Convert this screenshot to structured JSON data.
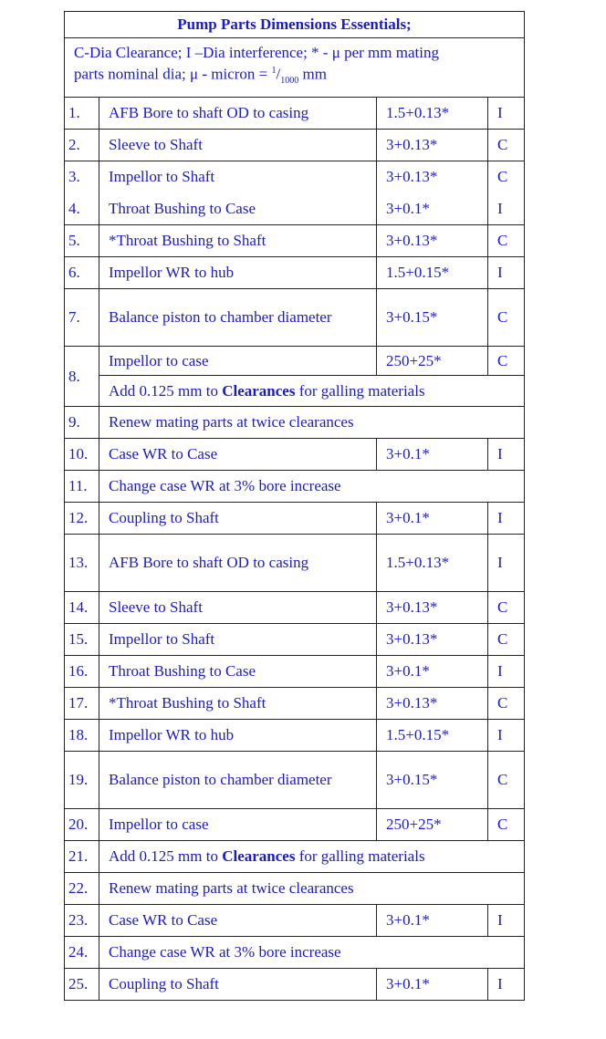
{
  "title": "Pump Parts Dimensions Essentials;",
  "legend": {
    "line1": "C-Dia Clearance; I –Dia  interference; * - μ per mm mating",
    "line2_a": "parts nominal dia; μ - micron = ",
    "sup": "1",
    "slash": "/",
    "sub": "1000",
    "line2_b": " mm"
  },
  "colors": {
    "text": "#1a1ad0",
    "border": "#222222"
  },
  "rows": [
    {
      "num": "1.",
      "part": "AFB Bore to shaft OD to casing",
      "value": "1.5+0.13*",
      "type": "I"
    },
    {
      "num": "2.",
      "part": "Sleeve to Shaft",
      "value": "3+0.13*",
      "type": "C"
    },
    {
      "num": "3.",
      "part": "Impellor to Shaft",
      "value": "3+0.13*",
      "type": "C"
    },
    {
      "num": "4.",
      "part": "Throat Bushing to Case",
      "value": "3+0.1*",
      "type": "I"
    },
    {
      "num": "5.",
      "part": "*Throat Bushing to Shaft",
      "value": "3+0.13*",
      "type": "C"
    },
    {
      "num": "6.",
      "part": "Impellor WR to hub",
      "value": "1.5+0.15*",
      "type": "I"
    },
    {
      "num": "7.",
      "part": "Balance piston to chamber diameter",
      "value": "3+0.15*",
      "type": "C"
    },
    {
      "num": "8.",
      "part": "Impellor to case",
      "value": "250+25*",
      "type": "C",
      "note_a": "Add 0.125 mm to ",
      "note_bold": "Clearances",
      "note_b": " for galling materials"
    },
    {
      "num": "9.",
      "note": "Renew mating parts at twice clearances"
    },
    {
      "num": "10.",
      "part": "Case WR to Case",
      "value": "3+0.1*",
      "type": "I"
    },
    {
      "num": "11.",
      "note": "Change case WR at 3% bore increase"
    },
    {
      "num": "12.",
      "part": "Coupling to Shaft",
      "value": "3+0.1*",
      "type": "I"
    },
    {
      "num": "13.",
      "part": "AFB Bore to shaft  OD to casing",
      "value": "1.5+0.13*",
      "type": "I"
    },
    {
      "num": "14.",
      "part": "Sleeve to Shaft",
      "value": "3+0.13*",
      "type": "C"
    },
    {
      "num": "15.",
      "part": "Impellor to Shaft",
      "value": "3+0.13*",
      "type": "C"
    },
    {
      "num": "16.",
      "part": "Throat Bushing to Case",
      "value": "3+0.1*",
      "type": "I"
    },
    {
      "num": "17.",
      "part": "*Throat Bushing to Shaft",
      "value": "3+0.13*",
      "type": "C"
    },
    {
      "num": "18.",
      "part": "Impellor WR to hub",
      "value": "1.5+0.15*",
      "type": "I"
    },
    {
      "num": "19.",
      "part": "Balance piston to chamber diameter",
      "value": "3+0.15*",
      "type": "C"
    },
    {
      "num": "20.",
      "part": "Impellor to case",
      "value": "250+25*",
      "type": "C"
    },
    {
      "num": "21.",
      "note_a": "Add 0.125 mm to ",
      "note_bold": "Clearances",
      "note_b": " for galling materials"
    },
    {
      "num": "22.",
      "note": "Renew mating parts at twice clearances"
    },
    {
      "num": "23.",
      "part": "Case WR to Case",
      "value": "3+0.1*",
      "type": "I"
    },
    {
      "num": "24.",
      "note": "Change case WR at 3% bore increase"
    },
    {
      "num": "25.",
      "part": "Coupling to Shaft",
      "value": "3+0.1*",
      "type": "I"
    }
  ]
}
